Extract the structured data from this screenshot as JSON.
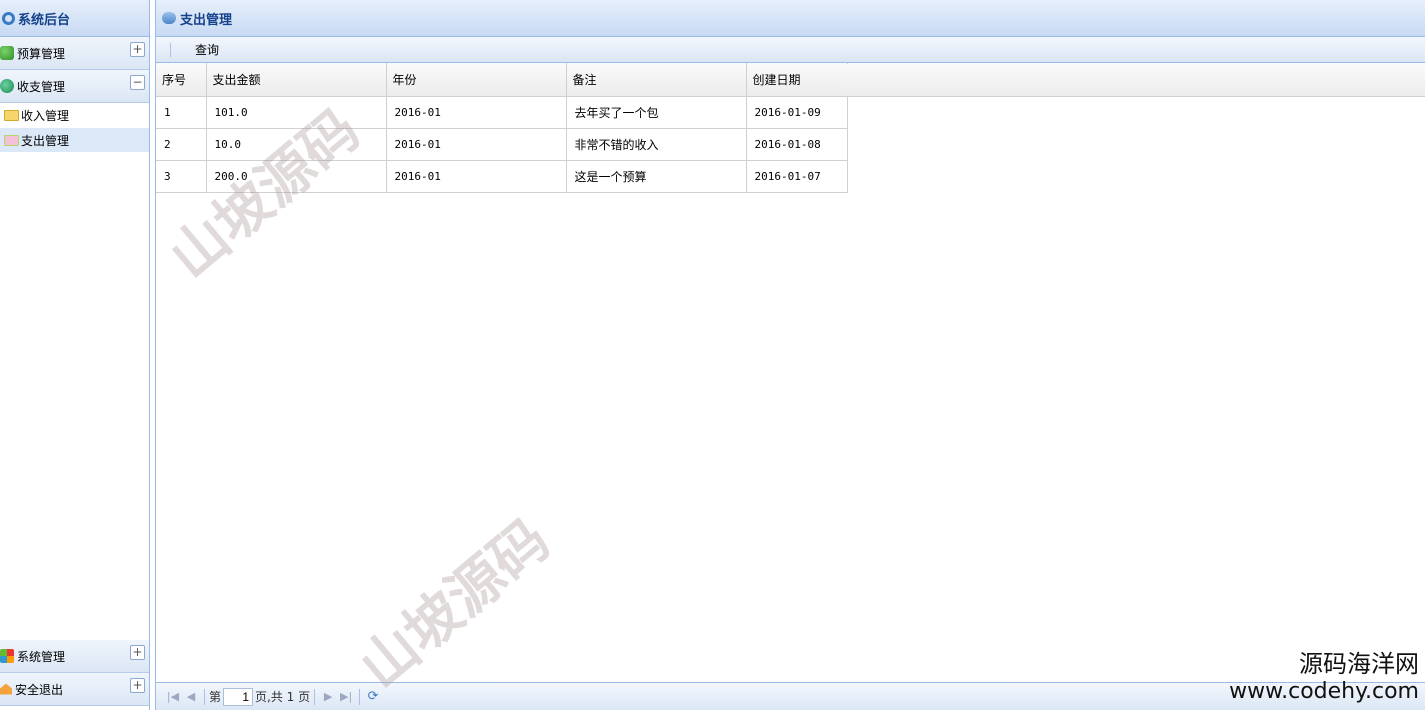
{
  "sidebar": {
    "title": "系统后台",
    "sections": [
      {
        "label": "预算管理",
        "toggle": "+"
      },
      {
        "label": "收支管理",
        "toggle": "−"
      }
    ],
    "tree": [
      {
        "label": "收入管理"
      },
      {
        "label": "支出管理"
      }
    ],
    "bottom_sections": [
      {
        "label": "系统管理",
        "toggle": "+"
      },
      {
        "label": "安全退出",
        "toggle": "+"
      }
    ]
  },
  "panel": {
    "title": "支出管理",
    "toolbar": {
      "query_label": "查询"
    }
  },
  "grid": {
    "columns": [
      "序号",
      "支出金额",
      "年份",
      "备注",
      "创建日期"
    ],
    "rows": [
      [
        "1",
        "101.0",
        "2016-01",
        "去年买了一个包",
        "2016-01-09"
      ],
      [
        "2",
        "10.0",
        "2016-01",
        "非常不错的收入",
        "2016-01-08"
      ],
      [
        "3",
        "200.0",
        "2016-01",
        "这是一个预算",
        "2016-01-07"
      ]
    ]
  },
  "pager": {
    "page_prefix": "第",
    "page_value": "1",
    "page_suffix": "页,共 1 页"
  },
  "watermarks": {
    "text": "山坡源码",
    "site_cn": "源码海洋网",
    "site_url": "www.codehy.com"
  }
}
